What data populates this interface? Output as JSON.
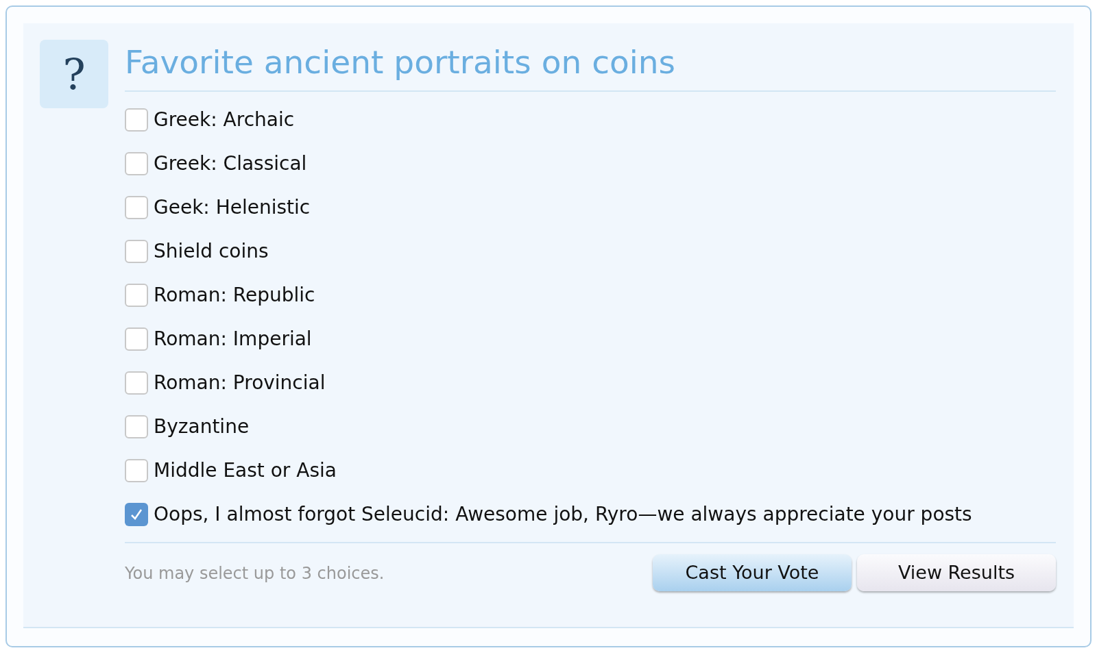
{
  "poll": {
    "icon": "?",
    "title": "Favorite ancient portraits on coins",
    "options": [
      {
        "label": "Greek: Archaic",
        "checked": false
      },
      {
        "label": "Greek: Classical",
        "checked": false
      },
      {
        "label": "Geek: Helenistic",
        "checked": false
      },
      {
        "label": "Shield coins",
        "checked": false
      },
      {
        "label": "Roman: Republic",
        "checked": false
      },
      {
        "label": "Roman: Imperial",
        "checked": false
      },
      {
        "label": "Roman: Provincial",
        "checked": false
      },
      {
        "label": "Byzantine",
        "checked": false
      },
      {
        "label": "Middle East or Asia",
        "checked": false
      },
      {
        "label": "Oops, I almost forgot Seleucid: Awesome job, Ryro—we always appreciate your posts",
        "checked": true
      }
    ],
    "hint": "You may select up to 3 choices.",
    "buttons": [
      {
        "label": "Cast Your Vote",
        "kind": "primary"
      },
      {
        "label": "View Results",
        "kind": "secondary"
      }
    ]
  }
}
